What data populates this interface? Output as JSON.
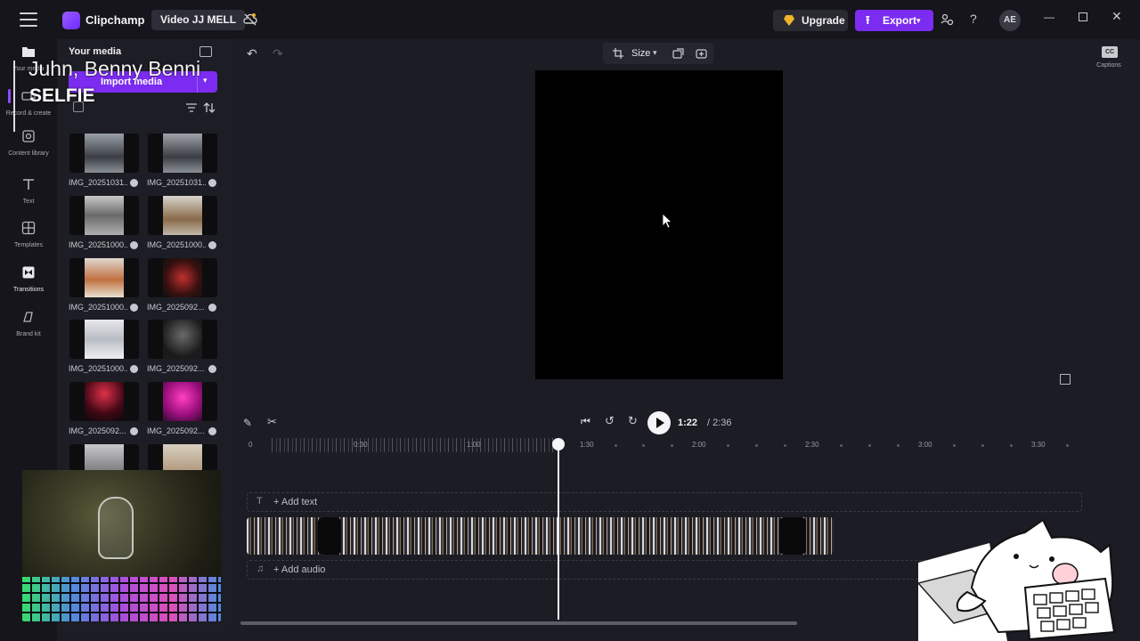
{
  "app": {
    "name": "Clipchamp",
    "project_name": "Video JJ MELL"
  },
  "header": {
    "upgrade_label": "Upgrade",
    "export_label": "Export",
    "avatar_initials": "AE"
  },
  "rail": {
    "items": [
      {
        "label": "Your media",
        "icon": "folder-icon"
      },
      {
        "label": "Record & create",
        "icon": "record-icon"
      },
      {
        "label": "Content library",
        "icon": "library-icon"
      },
      {
        "label": "Text",
        "icon": "text-icon"
      },
      {
        "label": "Templates",
        "icon": "templates-icon"
      },
      {
        "label": "Transitions",
        "icon": "transitions-icon"
      },
      {
        "label": "Brand kit",
        "icon": "brand-kit-icon"
      }
    ]
  },
  "media": {
    "title": "Your media",
    "import_label": "Import media",
    "items": [
      {
        "label": "IMG_20251031..."
      },
      {
        "label": "IMG_20251031..."
      },
      {
        "label": "IMG_20251000..."
      },
      {
        "label": "IMG_20251000..."
      },
      {
        "label": "IMG_20251000..."
      },
      {
        "label": "IMG_2025092..."
      },
      {
        "label": "IMG_20251000..."
      },
      {
        "label": "IMG_2025092..."
      },
      {
        "label": "IMG_2025092..."
      },
      {
        "label": "IMG_2025092..."
      }
    ]
  },
  "overlay": {
    "line1": "Juhn, Benny Benni",
    "line2": "SELFIE"
  },
  "preview": {
    "size_label": "Size"
  },
  "captions": {
    "icon_text": "CC",
    "label": "Captions"
  },
  "timeline": {
    "current_time": "1:22",
    "total_time": "/ 2:36",
    "ruler_labels": [
      "0",
      "0:30",
      "1:00",
      "1:30",
      "2:00",
      "2:30",
      "3:00",
      "3:30"
    ],
    "add_text_label": "+ Add text",
    "add_audio_label": "+ Add audio"
  },
  "colors": {
    "accent": "#7b2cf0",
    "background": "#1c1c24",
    "panel": "#15151b"
  }
}
